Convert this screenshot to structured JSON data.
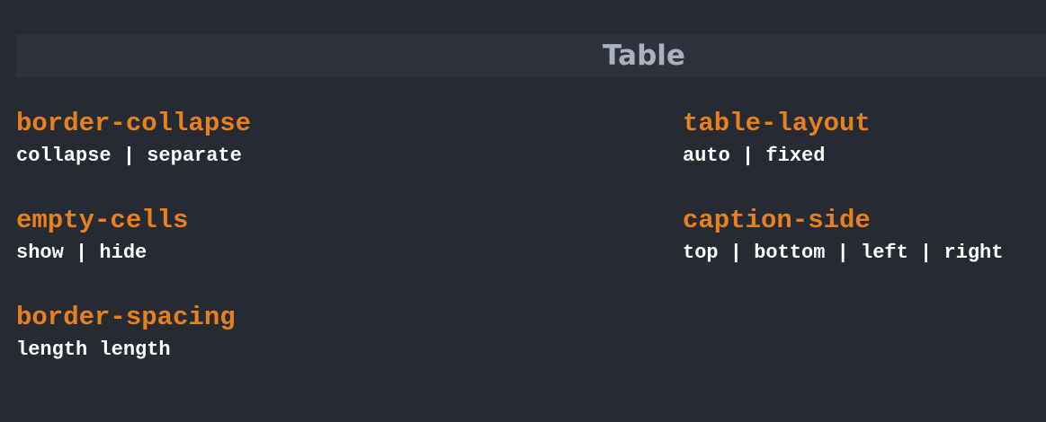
{
  "header": {
    "title": "Table"
  },
  "properties": [
    {
      "name": "border-collapse",
      "values": "collapse | separate"
    },
    {
      "name": "table-layout",
      "values": "auto | fixed"
    },
    {
      "name": "empty-cells",
      "values": "show | hide"
    },
    {
      "name": "caption-side",
      "values": "top | bottom | left | right"
    },
    {
      "name": "border-spacing",
      "values": "length length"
    }
  ],
  "colors": {
    "background": "#262a33",
    "header_bar": "#2d323c",
    "header_text": "#aab1c1",
    "property_name": "#e8801e",
    "property_values": "#ffffff"
  }
}
